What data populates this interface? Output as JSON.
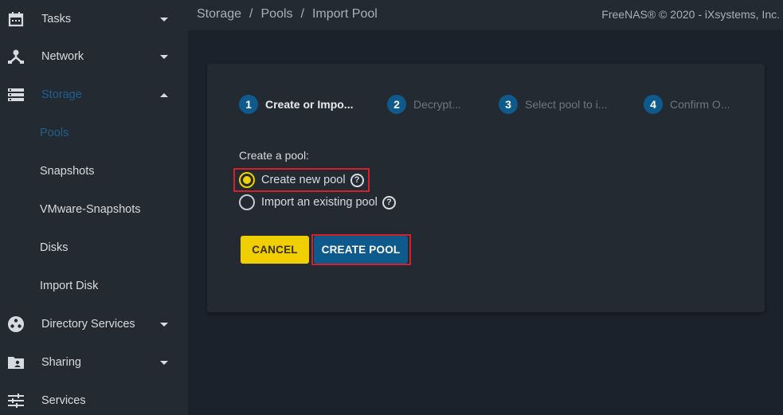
{
  "topbar": {
    "breadcrumb": [
      "Storage",
      "Pools",
      "Import Pool"
    ],
    "separator": "/",
    "copyright": "FreeNAS® © 2020 - iXsystems, Inc."
  },
  "sidebar": {
    "items": [
      {
        "label": "Tasks",
        "icon": "calendar-icon",
        "caret": "down"
      },
      {
        "label": "Network",
        "icon": "network-icon",
        "caret": "down"
      },
      {
        "label": "Storage",
        "icon": "storage-icon",
        "caret": "up",
        "active": true
      },
      {
        "label": "Directory Services",
        "icon": "directory-services-icon",
        "caret": "down"
      },
      {
        "label": "Sharing",
        "icon": "sharing-folder-icon",
        "caret": "down"
      },
      {
        "label": "Services",
        "icon": "services-sliders-icon"
      }
    ],
    "storage_sub": [
      {
        "label": "Pools",
        "active": true
      },
      {
        "label": "Snapshots"
      },
      {
        "label": "VMware-Snapshots"
      },
      {
        "label": "Disks"
      },
      {
        "label": "Import Disk"
      }
    ]
  },
  "wizard": {
    "steps": [
      {
        "num": "1",
        "label": "Create or Impo...",
        "active": true
      },
      {
        "num": "2",
        "label": "Decrypt..."
      },
      {
        "num": "3",
        "label": "Select pool to i..."
      },
      {
        "num": "4",
        "label": "Confirm O..."
      }
    ],
    "form_label": "Create a pool:",
    "options": [
      {
        "label": "Create new pool",
        "checked": true
      },
      {
        "label": "Import an existing pool",
        "checked": false
      }
    ],
    "help_glyph": "?",
    "cancel_label": "CANCEL",
    "create_label": "CREATE POOL"
  },
  "colors": {
    "accent_blue": "#0f5a8c",
    "accent_yellow": "#f0cf00",
    "highlight_red": "#d3202a",
    "sidebar_bg": "#232a32",
    "page_bg": "#1b222b"
  }
}
